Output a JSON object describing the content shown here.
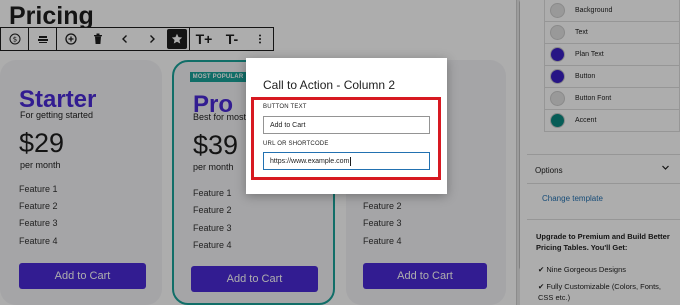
{
  "page": {
    "title": "Pricing"
  },
  "toolbar": {
    "buttons": [
      "$",
      "≡",
      "⊕",
      "🗑",
      "‹",
      "›",
      "★",
      "T+",
      "T-",
      "⋮"
    ]
  },
  "cards": [
    {
      "name": "Starter",
      "subtitle": "For getting started",
      "price": "$29",
      "period": "per month",
      "features": [
        "Feature 1",
        "Feature 2",
        "Feature 3",
        "Feature 4"
      ],
      "button": "Add to Cart"
    },
    {
      "name": "Pro",
      "subtitle": "Best for most u",
      "price": "$39",
      "period": "per month",
      "features": [
        "Feature 1",
        "Feature 2",
        "Feature 3",
        "Feature 4"
      ],
      "button": "Add to Cart",
      "badge": "MOST POPULAR"
    },
    {
      "name": "",
      "subtitle": "",
      "price": "",
      "period": "",
      "features": [
        "Feature 2",
        "Feature 3",
        "Feature 4"
      ],
      "button": "Add to Cart"
    }
  ],
  "modal": {
    "title": "Call to Action - Column 2",
    "button_text_label": "BUTTON TEXT",
    "button_text_value": "Add to Cart",
    "url_label": "URL OR SHORTCODE",
    "url_value": "https://www.example.com"
  },
  "sidebar": {
    "colors": [
      {
        "label": "Background",
        "color": "#e2e2e2"
      },
      {
        "label": "Text",
        "color": "#e2e2e2"
      },
      {
        "label": "Plan Text",
        "color": "#3a1fc4"
      },
      {
        "label": "Button",
        "color": "#3a1fc4"
      },
      {
        "label": "Button Font",
        "color": "#e2e2e2"
      },
      {
        "label": "Accent",
        "color": "#0b8a80"
      }
    ],
    "options_title": "Options",
    "change_template": "Change template",
    "upgrade_text": "Upgrade to Premium and Build Better Pricing Tables. You'll Get:",
    "benefits": [
      "Nine Gorgeous Designs",
      "Fully Customizable (Colors, Fonts, CSS etc.)"
    ]
  }
}
